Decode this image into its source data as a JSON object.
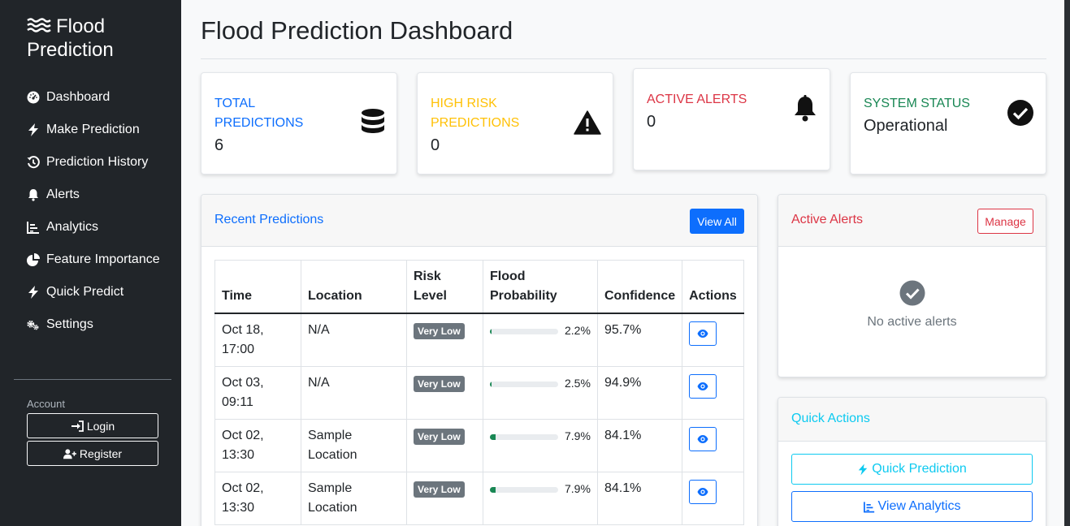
{
  "app": {
    "brand_line1": "Flood",
    "brand_line2": "Prediction"
  },
  "sidebar": {
    "items": [
      {
        "label": "Dashboard",
        "icon": "gauge-icon"
      },
      {
        "label": "Make Prediction",
        "icon": "bolt-icon"
      },
      {
        "label": "Prediction History",
        "icon": "history-icon"
      },
      {
        "label": "Alerts",
        "icon": "bell-icon"
      },
      {
        "label": "Analytics",
        "icon": "chart-icon"
      },
      {
        "label": "Feature Importance",
        "icon": "pie-chart-icon"
      },
      {
        "label": "Quick Predict",
        "icon": "bolt-icon"
      },
      {
        "label": "Settings",
        "icon": "gears-icon"
      }
    ],
    "account_label": "Account",
    "login_label": "Login",
    "register_label": "Register"
  },
  "page": {
    "title": "Flood Prediction Dashboard"
  },
  "stats": {
    "total": {
      "label": "TOTAL PREDICTIONS",
      "value": "6",
      "color": "#0d6efd"
    },
    "high_risk": {
      "label": "HIGH RISK PREDICTIONS",
      "value": "0",
      "color": "#ffc107"
    },
    "alerts": {
      "label": "ACTIVE ALERTS",
      "value": "0",
      "color": "#dc3545"
    },
    "status": {
      "label": "SYSTEM STATUS",
      "value": "Operational",
      "color": "#198754"
    }
  },
  "recent": {
    "title": "Recent Predictions",
    "view_all": "View All",
    "headers": [
      "Time",
      "Location",
      "Risk Level",
      "Flood Probability",
      "Confidence",
      "Actions"
    ],
    "rows": [
      {
        "time": "Oct 18, 17:00",
        "location": "N/A",
        "risk": "Very Low",
        "probability": 2.2,
        "probability_text": "2.2%",
        "confidence": "95.7%"
      },
      {
        "time": "Oct 03, 09:11",
        "location": "N/A",
        "risk": "Very Low",
        "probability": 2.5,
        "probability_text": "2.5%",
        "confidence": "94.9%"
      },
      {
        "time": "Oct 02, 13:30",
        "location": "Sample Location",
        "risk": "Very Low",
        "probability": 7.9,
        "probability_text": "7.9%",
        "confidence": "84.1%"
      },
      {
        "time": "Oct 02, 13:30",
        "location": "Sample Location",
        "risk": "Very Low",
        "probability": 7.9,
        "probability_text": "7.9%",
        "confidence": "84.1%"
      }
    ]
  },
  "active_alerts": {
    "title": "Active Alerts",
    "manage": "Manage",
    "empty_text": "No active alerts"
  },
  "quick_actions": {
    "title": "Quick Actions",
    "quick_prediction": "Quick Prediction",
    "view_analytics": "View Analytics"
  }
}
